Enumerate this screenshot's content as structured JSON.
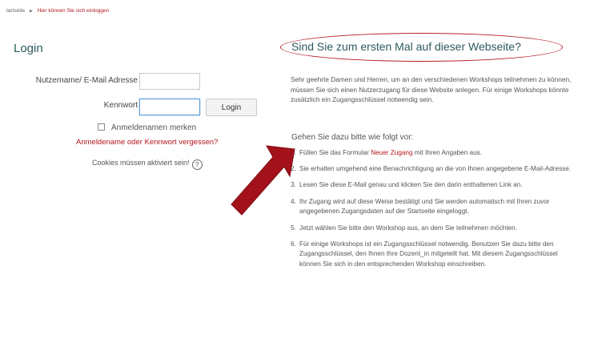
{
  "breadcrumb": {
    "home": "tartseite",
    "separator": "▶",
    "current": "Hier können Sie sich einloggen"
  },
  "login": {
    "title": "Login",
    "username_label": "Nutzername/ E-Mail Adresse",
    "username_value": "",
    "password_label": "Kennwort",
    "password_value": "",
    "login_button": "Login",
    "remember_label": "Anmeldenamen merken",
    "forgot_link": "Anmeldename oder Kennwort vergessen?",
    "cookies_note": "Cookies müssen aktiviert sein!",
    "help_glyph": "?"
  },
  "first_time": {
    "title": "Sind Sie zum ersten Mal auf dieser Webseite?",
    "intro": "Sehr geehrte Damen und Herren, um an den verschiedenen Workshops teilnehmen zu können, müssen Sie sich einen Nutzerzugang für diese Website anlegen. Für einige Workshops könnte zusätzlich ein Zugangsschlüssel notwendig sein.",
    "steps_heading": "Gehen Sie dazu bitte wie folgt vor:",
    "steps": [
      {
        "num": "1.",
        "before": "Füllen Sie das Formular ",
        "link": "Neuer Zugang",
        "after": " mit Ihren Angaben aus."
      },
      {
        "num": "2.",
        "before": "Sie erhalten umgehend eine Benachrichtigung an die von Ihnen angegebene E-Mail-Adresse.",
        "link": "",
        "after": ""
      },
      {
        "num": "3.",
        "before": "Lesen Sie diese E-Mail genau und klicken Sie den darin enthaltenen Link an.",
        "link": "",
        "after": ""
      },
      {
        "num": "4.",
        "before": "Ihr Zugang wird auf diese Weise bestätigt und Sie werden automatisch mit Ihren zuvor angegebenen Zugangsdaten auf der Startseite eingeloggt.",
        "link": "",
        "after": ""
      },
      {
        "num": "5.",
        "before": "Jetzt wählen Sie bitte den Workshop aus, an dem Sie teilnehmen möchten.",
        "link": "",
        "after": ""
      },
      {
        "num": "6.",
        "before": "Für einige Workshops ist ein Zugangsschlüssel notwendig. Benutzen Sie dazu bitte den Zugangsschlüssel, den Ihnen Ihre Dozent_in mitgeteilt hat. Mit diesem Zugangsschlüssel können Sie sich in den entsprechenden Workshop einschreiben.",
        "link": "",
        "after": ""
      }
    ]
  },
  "colors": {
    "accent_red": "#b4151b",
    "heading_teal": "#2d5a5c",
    "arrow_red": "#a3111a"
  },
  "icons": {
    "breadcrumb_separator": "triangle-right-icon",
    "help": "question-circle-icon",
    "annotation": "red-arrow-icon"
  }
}
